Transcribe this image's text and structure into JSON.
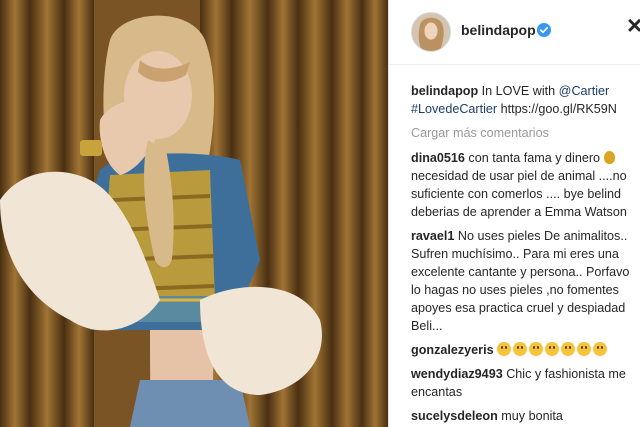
{
  "post": {
    "username": "belindapop",
    "verified_icon": "verified-badge-icon",
    "close_icon": "close-icon",
    "load_more": "Cargar más comentarios"
  },
  "caption": {
    "user": "belindapop",
    "line1_text": " In LOVE with ",
    "mention": "@Cartier",
    "hashtag": "#LovedeCartier",
    "url": " https://goo.gl/RK59N"
  },
  "comments": [
    {
      "user": "dina0516",
      "lines": [
        " con tanta fama y dinero ",
        "necesidad de usar piel de animal ....no",
        "suficiente con comerlos .... bye belind",
        "deberias de aprender a Emma Watson"
      ]
    },
    {
      "user": "ravael1",
      "lines": [
        " No uses pieles De animalitos..",
        "Sufren muchísimo.. Para mi eres una",
        "excelente cantante y persona.. Porfavo",
        "lo hagas no uses pieles ,no fomentes",
        "apoyes esa practica cruel y despiadad",
        "Beli..."
      ]
    },
    {
      "user": "gonzalezyeris",
      "emoji_count": 7
    },
    {
      "user": "wendydiaz9493",
      "lines": [
        " Chic y fashionista me",
        "encantas"
      ]
    },
    {
      "user": "sucelysdeleon",
      "lines": [
        " muy bonita"
      ]
    }
  ],
  "colors": {
    "link": "#1a3d6b",
    "muted": "#999999",
    "verified": "#3897f0"
  }
}
